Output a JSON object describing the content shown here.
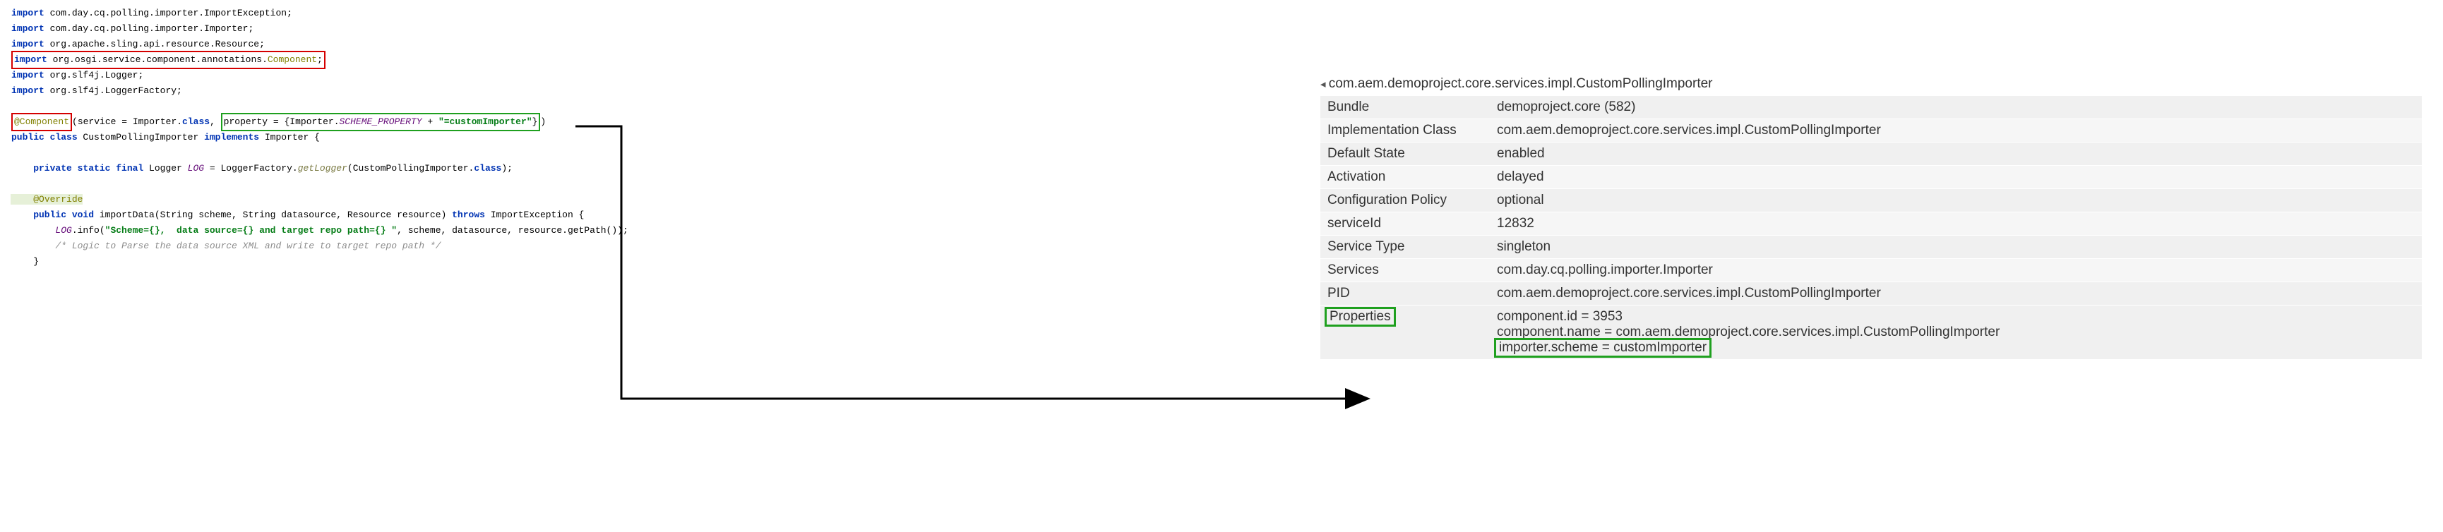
{
  "code": {
    "imports": [
      {
        "kw": "import",
        "pkg": "com.day.cq.polling.importer.ImportException;"
      },
      {
        "kw": "import",
        "pkg": "com.day.cq.polling.importer.Importer;"
      },
      {
        "kw": "import",
        "pkg": "org.apache.sling.api.resource.Resource;"
      },
      {
        "kw": "import",
        "pkg": "org.osgi.service.component.annotations.",
        "last": "Component",
        "sfx": ";",
        "boxed": "red"
      },
      {
        "kw": "import",
        "pkg": "org.slf4j.Logger;"
      },
      {
        "kw": "import",
        "pkg": "org.slf4j.LoggerFactory;"
      }
    ],
    "annotation": {
      "at": "@Component",
      "open": "(service = Importer.",
      "cls": "class",
      "mid": ", ",
      "prop_box": "property = {Importer.",
      "scheme_const": "SCHEME_PROPERTY",
      "plus": " + ",
      "str": "\"=customImporter\"",
      "close": "}",
      "paren": ")"
    },
    "classdecl": {
      "p1": "public class",
      "name": " CustomPollingImporter ",
      "p2": "implements",
      "iface": " Importer {"
    },
    "logline": {
      "p1": "    private static final",
      "type": " Logger ",
      "var": "LOG",
      "eq": " = LoggerFactory.",
      "m": "getLogger",
      "arg": "(CustomPollingImporter.",
      "cls": "class",
      "end": ");"
    },
    "override": "    @Override",
    "methoddecl": {
      "p1": "    public void",
      "name": " importData(String scheme, String datasource, Resource resource) ",
      "p2": "throws",
      "exc": " ImportException {"
    },
    "loginfo": {
      "pre": "        ",
      "var": "LOG",
      "dot": ".info(",
      "str": "\"Scheme={},  data source={} and target repo path={} \"",
      "post": ", scheme, datasource, resource.getPath());"
    },
    "comment": "        /* Logic to Parse the data source XML and write to target repo path */",
    "closebrace": "    }"
  },
  "table": {
    "header": "com.aem.demoproject.core.services.impl.CustomPollingImporter",
    "rows": [
      {
        "label": "Bundle",
        "value": "demoproject.core (582)"
      },
      {
        "label": "Implementation Class",
        "value": "com.aem.demoproject.core.services.impl.CustomPollingImporter"
      },
      {
        "label": "Default State",
        "value": "enabled"
      },
      {
        "label": "Activation",
        "value": "delayed"
      },
      {
        "label": "Configuration Policy",
        "value": "optional"
      },
      {
        "label": "serviceId",
        "value": "12832"
      },
      {
        "label": "Service Type",
        "value": "singleton"
      },
      {
        "label": "Services",
        "value": "com.day.cq.polling.importer.Importer"
      },
      {
        "label": "PID",
        "value": "com.aem.demoproject.core.services.impl.CustomPollingImporter"
      }
    ],
    "props_label": "Properties",
    "props_values": {
      "l1": "component.id = 3953",
      "l2": "component.name = com.aem.demoproject.core.services.impl.CustomPollingImporter",
      "l3": "importer.scheme = customImporter"
    }
  }
}
